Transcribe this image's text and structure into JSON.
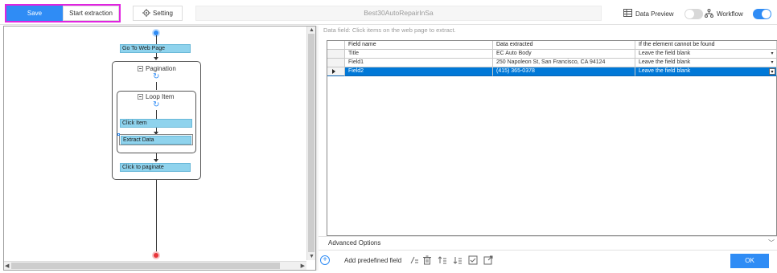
{
  "toolbar": {
    "save_label": "Save",
    "start_label": "Start extraction",
    "setting_label": "Setting",
    "task_name": "Best30AutoRepairInSa",
    "data_preview_label": "Data Preview",
    "data_preview_on": false,
    "workflow_label": "Workflow",
    "workflow_on": true
  },
  "workflow": {
    "steps": {
      "go_to_page": "Go To Web Page",
      "pagination": "Pagination",
      "loop_item": "Loop Item",
      "click_item": "Click Item",
      "extract_data": "Extract Data",
      "click_paginate": "Click to paginate"
    },
    "colors": {
      "start_dot": "#2f8cf5",
      "end_dot": "#e8353a",
      "step_fill": "#8fd3ed"
    }
  },
  "extraction": {
    "hint": "Data field: Click items on the web page to extract.",
    "columns": [
      "Field name",
      "Data extracted",
      "If the element cannot be found"
    ],
    "rows": [
      {
        "field": "Title",
        "value": "EC Auto Body",
        "fallback": "Leave the field blank"
      },
      {
        "field": "Field1",
        "value": "250 Napoleon St, San Francisco, CA 94124",
        "fallback": "Leave the field blank"
      },
      {
        "field": "Field2",
        "value": "(415) 365-0378",
        "fallback": "Leave the field blank"
      }
    ],
    "selected_row": 2,
    "advanced_label": "Advanced Options",
    "add_field_label": "Add predefined field",
    "ok_label": "OK"
  },
  "icons": {
    "setting": "gear-icon",
    "data_preview": "table-icon",
    "workflow": "flow-icon",
    "add": "plus-circle-icon",
    "bottom_tools": [
      "rename-icon",
      "delete-icon",
      "move-up-icon",
      "move-down-icon",
      "check-icon",
      "open-icon"
    ]
  }
}
